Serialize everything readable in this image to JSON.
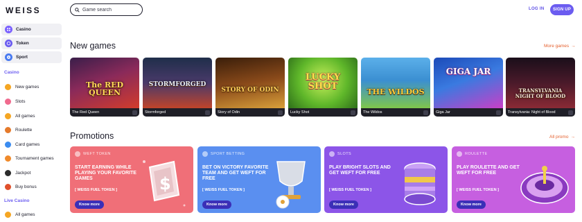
{
  "header": {
    "logo": "WEISS",
    "search_placeholder": "Game search",
    "login": "LOG IN",
    "signup": "SIGN UP"
  },
  "sidebar": {
    "top": [
      {
        "label": "Casino",
        "icon": "casino-icon",
        "color": "#7b61ff"
      },
      {
        "label": "Token",
        "icon": "token-icon",
        "color": "#6b5cf0"
      },
      {
        "label": "Sport",
        "icon": "sport-icon",
        "color": "#4a7bf0"
      }
    ],
    "casino_heading": "Casino",
    "casino_items": [
      {
        "label": "New games",
        "icon": "new-games-icon",
        "color": "#f5a623"
      },
      {
        "label": "Slots",
        "icon": "slots-icon",
        "color": "#f06a8e"
      },
      {
        "label": "All games",
        "icon": "all-games-icon",
        "color": "#f5a623"
      },
      {
        "label": "Roulette",
        "icon": "roulette-icon",
        "color": "#e57a2b"
      },
      {
        "label": "Card games",
        "icon": "card-games-icon",
        "color": "#3b8cf0"
      },
      {
        "label": "Tournament games",
        "icon": "tournament-icon",
        "color": "#f08a2b"
      },
      {
        "label": "Jackpot",
        "icon": "jackpot-icon",
        "color": "#2b2b2b"
      },
      {
        "label": "Buy bonus",
        "icon": "buy-bonus-icon",
        "color": "#e0502b"
      }
    ],
    "live_heading": "Live Casino",
    "live_items": [
      {
        "label": "All games",
        "icon": "live-all-games-icon",
        "color": "#f5a623"
      }
    ]
  },
  "new_games": {
    "title": "New games",
    "more_label": "More games",
    "games": [
      {
        "name": "The Red Queen",
        "art_text": "The RED QUEEN",
        "bg": "#6b2a6a",
        "bg2": "#c8352f"
      },
      {
        "name": "Stormforged",
        "art_text": "STORMFORGED",
        "bg": "#2f3d57",
        "bg2": "#b43a2a"
      },
      {
        "name": "Story of Odin",
        "art_text": "STORY OF ODIN",
        "bg": "#6b3a1a",
        "bg2": "#c9862e"
      },
      {
        "name": "Lucky Shot",
        "art_text": "LUCKY SHOT",
        "bg": "#3f8e2a",
        "bg2": "#9fd53a"
      },
      {
        "name": "The Wildos",
        "art_text": "THE WILDOS",
        "bg": "#3b8fd1",
        "bg2": "#7fc64b"
      },
      {
        "name": "Giga Jar",
        "art_text": "GIGA JAR",
        "bg": "#2a58c4",
        "bg2": "#c93fc7"
      },
      {
        "name": "Transylvania: Night of Blood",
        "art_text": "TRANSYLVANIA NIGHT OF BLOOD",
        "bg": "#2a1626",
        "bg2": "#7a2a35"
      }
    ]
  },
  "promotions": {
    "title": "Promotions",
    "more_label": "All promo",
    "cards": [
      {
        "tag": "WEFT TOKEN",
        "headline": "START EARNING WHILE PLAYING YOUR FAVORITE GAMES",
        "sub": "[ WEISS FUEL TOKEN ]",
        "button": "Know more",
        "bg": "#f06f78"
      },
      {
        "tag": "SPORT BETTING",
        "headline": "BET ON VICTORY FAVORITE TEAM AND GET WEFT FOR FREE",
        "sub": "[ WEISS FUEL TOKEN ]",
        "button": "Know more",
        "bg": "#5a8ff0"
      },
      {
        "tag": "SLOTS",
        "headline": "PLAY BRIGHT SLOTS AND GET WEFT FOR FREE",
        "sub": "[ WEISS FUEL TOKEN ]",
        "button": "Know more",
        "bg": "#8c55e8"
      },
      {
        "tag": "ROULETTE",
        "headline": "PLAY ROULETTE AND GET WEFT FOR FREE",
        "sub": "[ WEISS FUEL TOKEN ]",
        "button": "Know more",
        "bg": "#c65fe0"
      }
    ]
  }
}
